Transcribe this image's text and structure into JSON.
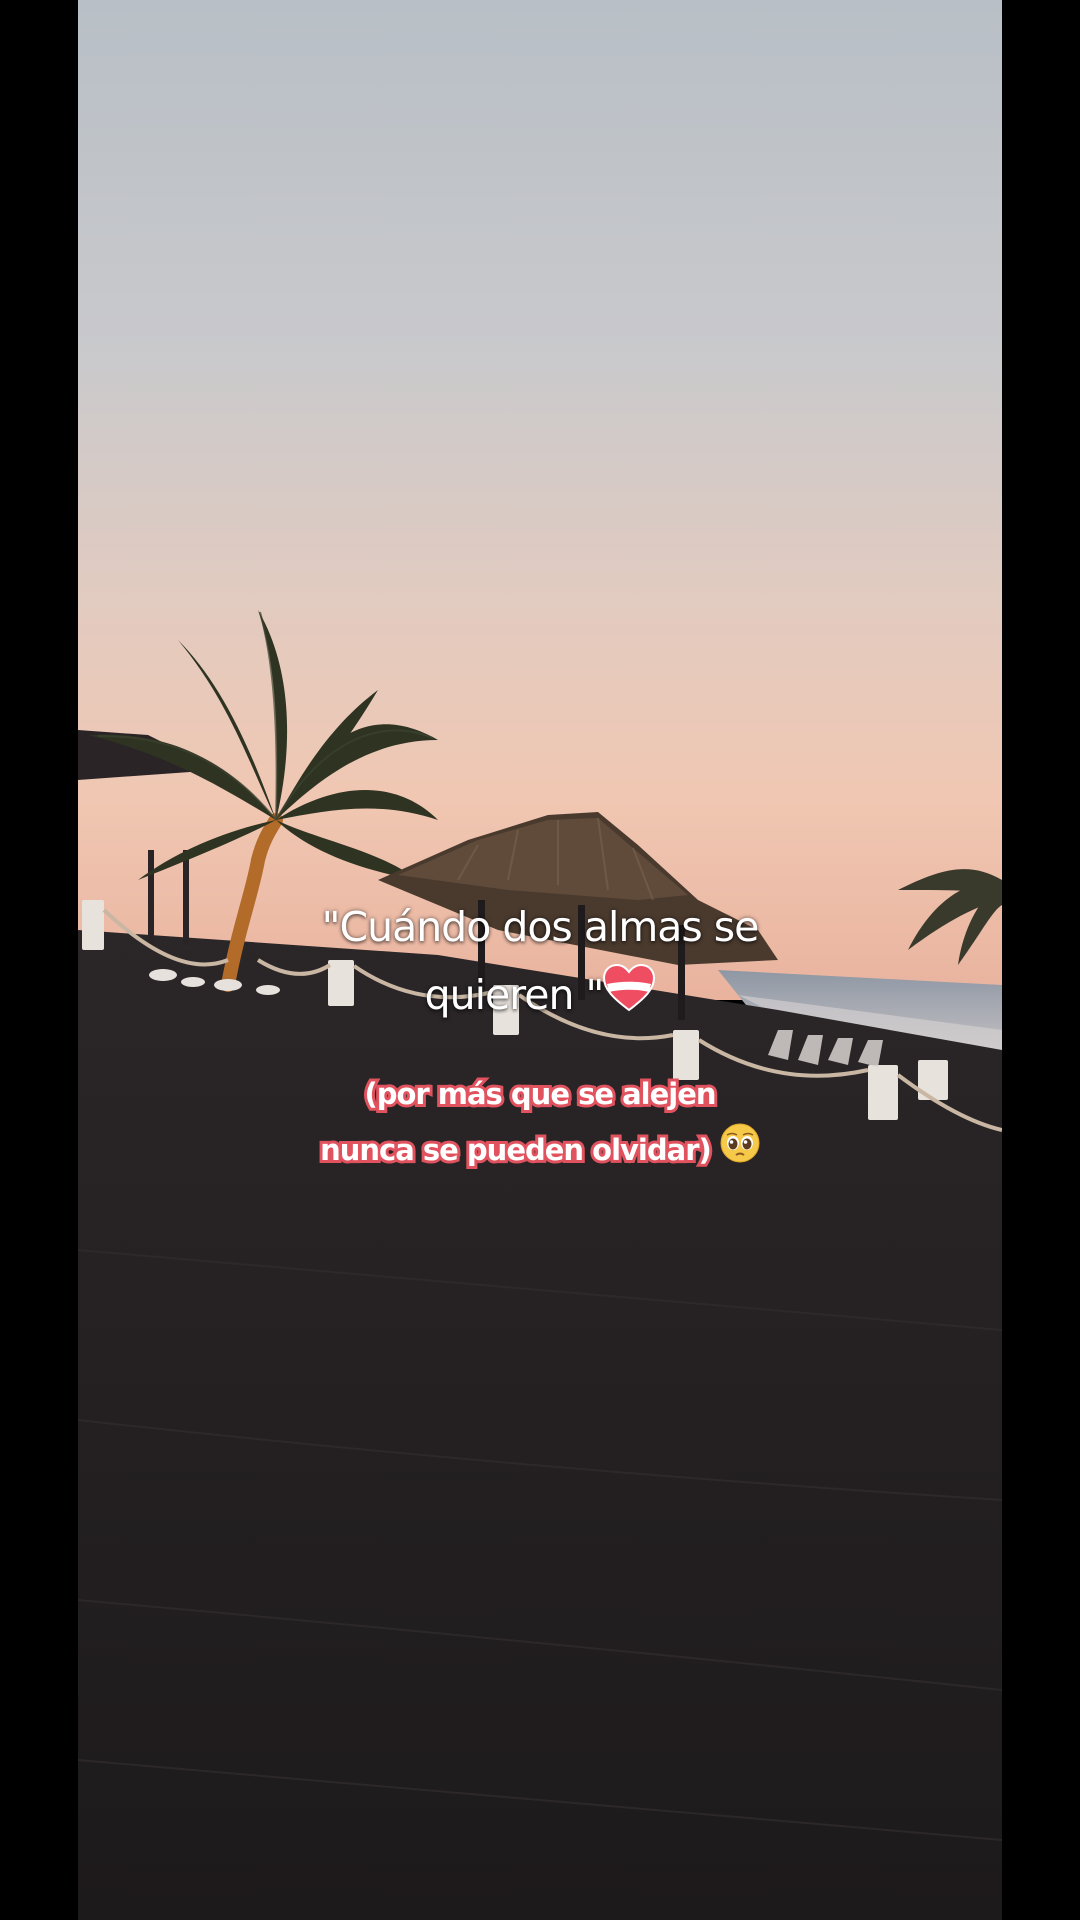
{
  "caption": {
    "line1": "\"Cuándo dos almas se",
    "line2_text": "quieren \"",
    "line2_emoji": "heart-emoji",
    "sub_line1": "(por más que se alejen",
    "sub_line2_text": "nunca se pueden olvidar)",
    "sub_line2_emoji": "pleading-face-emoji"
  },
  "colors": {
    "letterbox": "#000000",
    "sky_top": "#b9c0c6",
    "sky_horizon": "#e9c8b8",
    "sand": "#231f22",
    "caption_accent": "#e0525e"
  }
}
